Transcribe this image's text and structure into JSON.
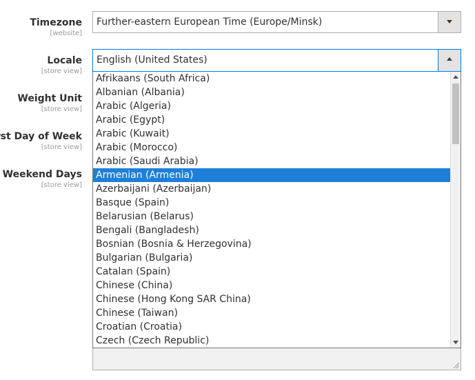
{
  "fields": {
    "timezone": {
      "label": "Timezone",
      "scope": "[website]",
      "value": "Further-eastern European Time (Europe/Minsk)"
    },
    "locale": {
      "label": "Locale",
      "scope": "[store view]",
      "value": "English (United States)"
    },
    "weight_unit": {
      "label": "Weight Unit",
      "scope": "[store view]"
    },
    "first_day": {
      "label": "First Day of Week",
      "scope": "[store view]"
    },
    "weekend_days": {
      "label": "Weekend Days",
      "scope": "[store view]"
    }
  },
  "locale_options": [
    "Afrikaans (South Africa)",
    "Albanian (Albania)",
    "Arabic (Algeria)",
    "Arabic (Egypt)",
    "Arabic (Kuwait)",
    "Arabic (Morocco)",
    "Arabic (Saudi Arabia)",
    "Armenian (Armenia)",
    "Azerbaijani (Azerbaijan)",
    "Basque (Spain)",
    "Belarusian (Belarus)",
    "Bengali (Bangladesh)",
    "Bosnian (Bosnia & Herzegovina)",
    "Bulgarian (Bulgaria)",
    "Catalan (Spain)",
    "Chinese (China)",
    "Chinese (Hong Kong SAR China)",
    "Chinese (Taiwan)",
    "Croatian (Croatia)",
    "Czech (Czech Republic)"
  ],
  "highlighted_option": "Armenian (Armenia)",
  "icons": {
    "select_arrow": "chevron-down-icon",
    "select_arrow_open": "chevron-up-icon",
    "scroll_up": "scroll-up-arrow-icon",
    "scroll_down": "scroll-down-arrow-icon",
    "resize": "resize-grip-icon"
  },
  "colors": {
    "highlight": "#1e7fd8",
    "focus_border": "#007bdb",
    "label_text": "#303030",
    "scope_text": "#999999"
  }
}
